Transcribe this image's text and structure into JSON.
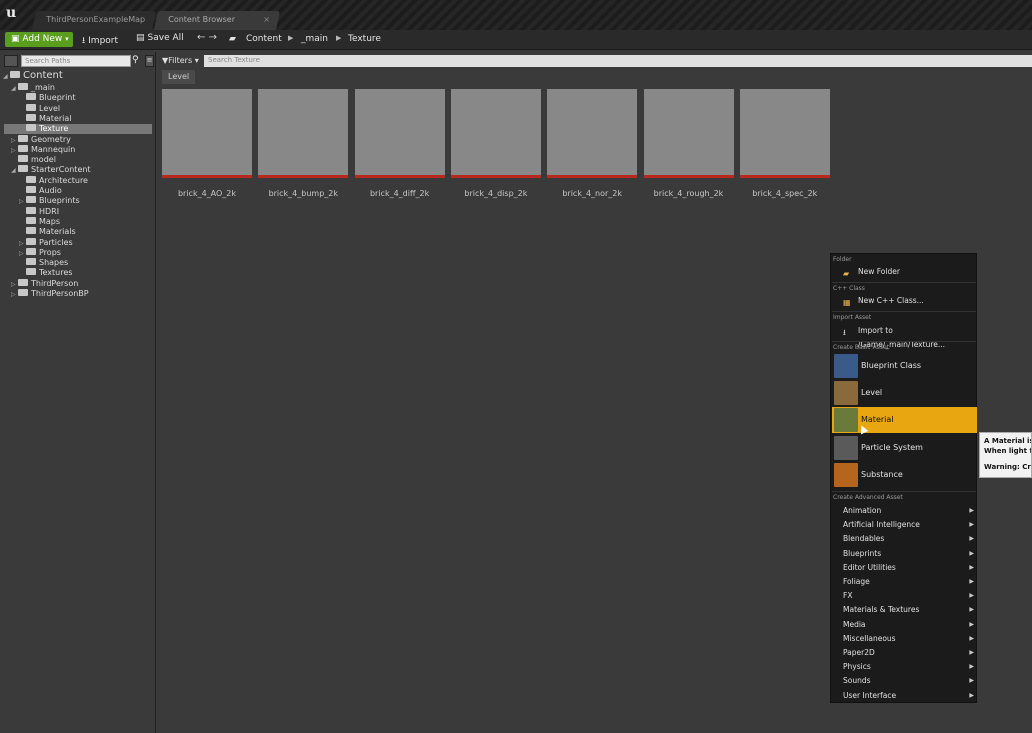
{
  "tabs": [
    {
      "label": "ThirdPersonExampleMap"
    },
    {
      "label": "Content Browser"
    }
  ],
  "toolbar": {
    "add_new": "Add New",
    "import": "Import",
    "save_all": "Save All"
  },
  "breadcrumb": [
    "Content",
    "_main",
    "Texture"
  ],
  "left_panel": {
    "search_placeholder": "Search Paths",
    "tree": [
      {
        "label": "Content",
        "level": 0,
        "expanded": true
      },
      {
        "label": "_main",
        "level": 1,
        "expanded": true
      },
      {
        "label": "Blueprint",
        "level": 2
      },
      {
        "label": "Level",
        "level": 2
      },
      {
        "label": "Material",
        "level": 2
      },
      {
        "label": "Texture",
        "level": 2,
        "selected": true
      },
      {
        "label": "Geometry",
        "level": 1,
        "expandable": true
      },
      {
        "label": "Mannequin",
        "level": 1,
        "expandable": true
      },
      {
        "label": "model",
        "level": 1
      },
      {
        "label": "StarterContent",
        "level": 1,
        "expanded": true
      },
      {
        "label": "Architecture",
        "level": 2
      },
      {
        "label": "Audio",
        "level": 2
      },
      {
        "label": "Blueprints",
        "level": 2,
        "expandable": true
      },
      {
        "label": "HDRI",
        "level": 2
      },
      {
        "label": "Maps",
        "level": 2
      },
      {
        "label": "Materials",
        "level": 2
      },
      {
        "label": "Particles",
        "level": 2,
        "expandable": true
      },
      {
        "label": "Props",
        "level": 2,
        "expandable": true
      },
      {
        "label": "Shapes",
        "level": 2
      },
      {
        "label": "Textures",
        "level": 2
      },
      {
        "label": "ThirdPerson",
        "level": 1,
        "expandable": true
      },
      {
        "label": "ThirdPersonBP",
        "level": 1,
        "expandable": true
      }
    ]
  },
  "content": {
    "filters_label": "Filters",
    "search_placeholder": "Search Texture",
    "level_tab": "Level",
    "assets": [
      {
        "name": "brick_4_AO_2k",
        "style": "brick-w"
      },
      {
        "name": "brick_4_bump_2k",
        "style": "brick-bump"
      },
      {
        "name": "brick_4_diff_2k",
        "style": "brick-diff"
      },
      {
        "name": "brick_4_disp_2k",
        "style": "brick-disp"
      },
      {
        "name": "brick_4_nor_2k",
        "style": "brick-nor"
      },
      {
        "name": "brick_4_rough_2k",
        "style": "brick-rough"
      },
      {
        "name": "brick_4_spec_2k",
        "style": "brick-spec"
      }
    ]
  },
  "context_menu": {
    "folder_section": "Folder",
    "new_folder": "New Folder",
    "cpp_section": "C++ Class",
    "new_cpp": "New C++ Class...",
    "import_section": "Import Asset",
    "import_to": "Import to /Game/_main/Texture...",
    "basic_section": "Create Basic Asset",
    "basic": [
      {
        "label": "Blueprint Class",
        "color": "#3a5a8a"
      },
      {
        "label": "Level",
        "color": "#8a6a3a"
      },
      {
        "label": "Material",
        "color": "#6a7a3a",
        "highlighted": true
      },
      {
        "label": "Particle System",
        "color": "#5a5a5a"
      },
      {
        "label": "Substance",
        "color": "#b5651d"
      }
    ],
    "advanced_section": "Create Advanced Asset",
    "advanced": [
      "Animation",
      "Artificial Intelligence",
      "Blendables",
      "Blueprints",
      "Editor Utilities",
      "Foliage",
      "FX",
      "Materials & Textures",
      "Media",
      "Miscellaneous",
      "Paper2D",
      "Physics",
      "Sounds",
      "User Interface"
    ]
  },
  "tooltip": {
    "line1": "A Material is a",
    "line2": "When light fro",
    "line3": "Warning: Crea"
  }
}
